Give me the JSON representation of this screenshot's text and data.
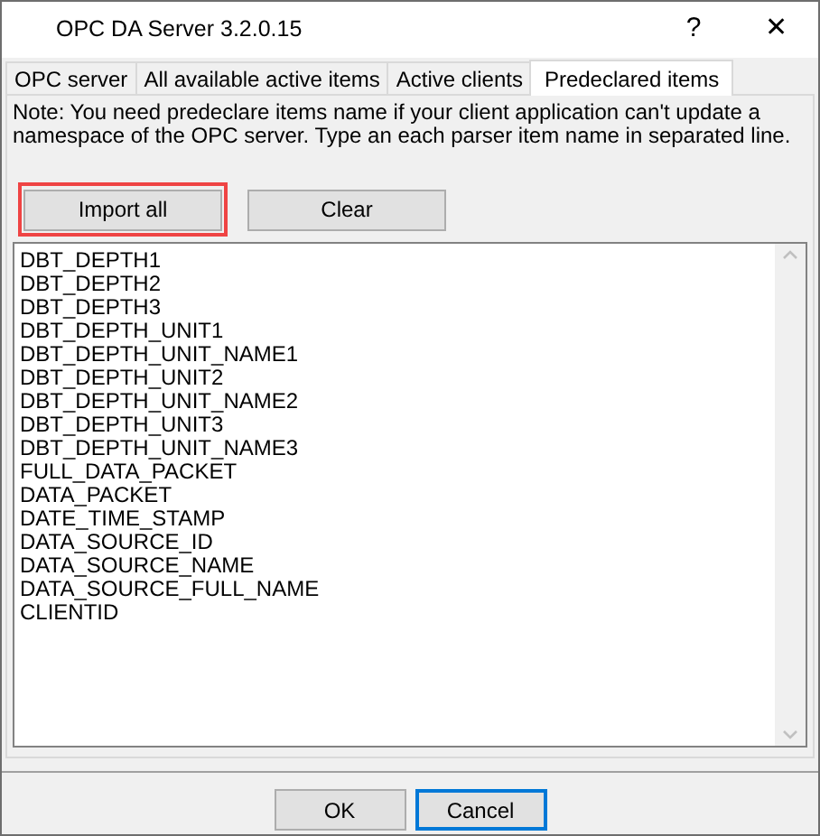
{
  "window": {
    "title": "OPC DA Server 3.2.0.15",
    "help_button": "?",
    "close_button": "✕"
  },
  "tabs": [
    {
      "label": "OPC server",
      "selected": false
    },
    {
      "label": "All available active items",
      "selected": false
    },
    {
      "label": "Active clients",
      "selected": false
    },
    {
      "label": "Predeclared items",
      "selected": true
    }
  ],
  "note": "Note: You need predeclare items name if your client application can't update a namespace of the OPC server. Type an each parser item name in separated line.",
  "actions": [
    {
      "label": "Import all",
      "highlighted": true
    },
    {
      "label": "Clear",
      "highlighted": false
    }
  ],
  "items": [
    "DBT_DEPTH1",
    "DBT_DEPTH2",
    "DBT_DEPTH3",
    "DBT_DEPTH_UNIT1",
    "DBT_DEPTH_UNIT_NAME1",
    "DBT_DEPTH_UNIT2",
    "DBT_DEPTH_UNIT_NAME2",
    "DBT_DEPTH_UNIT3",
    "DBT_DEPTH_UNIT_NAME3",
    "FULL_DATA_PACKET",
    "DATA_PACKET",
    "DATE_TIME_STAMP",
    "DATA_SOURCE_ID",
    "DATA_SOURCE_NAME",
    "DATA_SOURCE_FULL_NAME",
    "CLIENTID"
  ],
  "buttons": [
    {
      "label": "OK",
      "focused": false
    },
    {
      "label": "Cancel",
      "focused": true
    }
  ]
}
